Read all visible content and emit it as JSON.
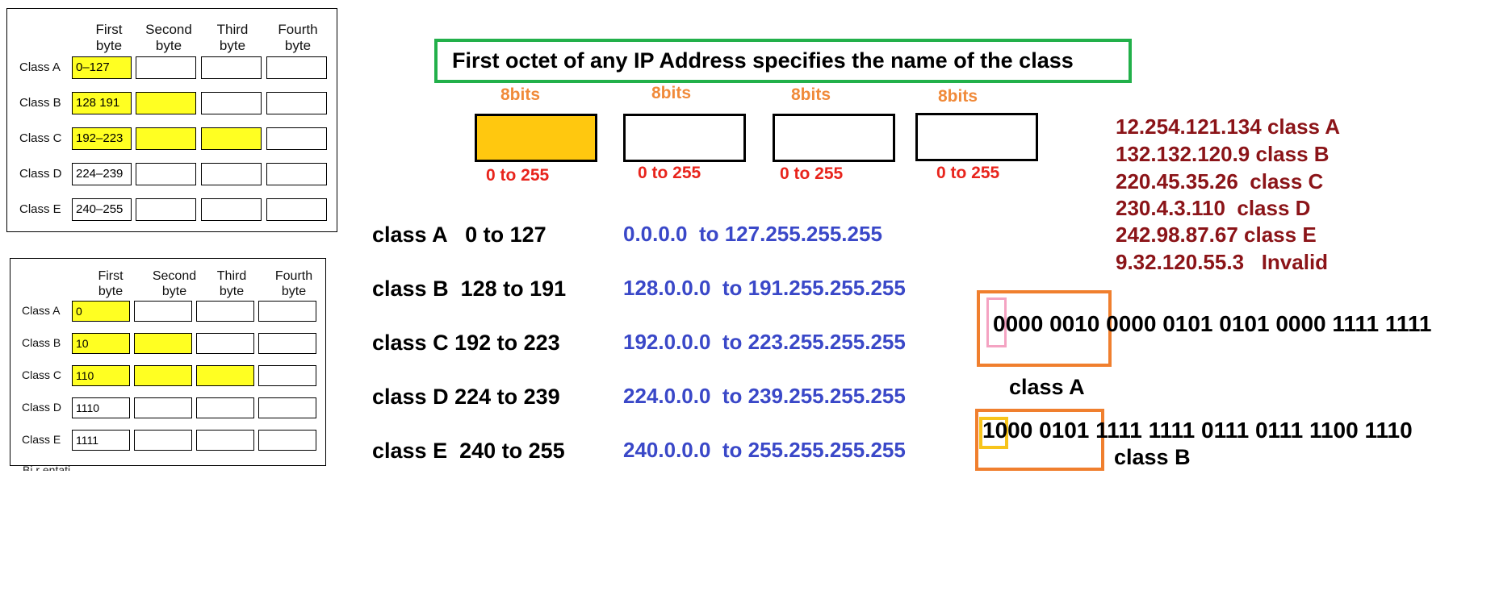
{
  "table1": {
    "headers": [
      "First byte",
      "Second byte",
      "Third byte",
      "Fourth byte"
    ],
    "rows": [
      {
        "label": "Class A",
        "value": "0–127",
        "filled": 1
      },
      {
        "label": "Class B",
        "value": "128  191",
        "filled": 2
      },
      {
        "label": "Class C",
        "value": "192–223",
        "filled": 3
      },
      {
        "label": "Class D",
        "value": "224–239",
        "filled": 0
      },
      {
        "label": "Class E",
        "value": "240–255",
        "filled": 0
      }
    ]
  },
  "table2": {
    "headers": [
      "First byte",
      "Second byte",
      "Third byte",
      "Fourth byte"
    ],
    "rows": [
      {
        "label": "Class A",
        "value": "0",
        "filled": 1
      },
      {
        "label": "Class B",
        "value": "10",
        "filled": 2
      },
      {
        "label": "Class C",
        "value": "110",
        "filled": 3
      },
      {
        "label": "Class D",
        "value": "1110",
        "filled": 0
      },
      {
        "label": "Class E",
        "value": "1111",
        "filled": 0
      }
    ],
    "cut_text": "Bi  r  entati"
  },
  "title": "First octet of any IP Address specifies the name of the class",
  "octets": [
    {
      "bits": "8bits",
      "range": "0 to 255"
    },
    {
      "bits": "8bits",
      "range": "0 to 255"
    },
    {
      "bits": "8bits",
      "range": "0 to 255"
    },
    {
      "bits": "8bits",
      "range": "0 to 255"
    }
  ],
  "classes": [
    {
      "name": "class A   0 to 127",
      "range": "0.0.0.0  to 127.255.255.255"
    },
    {
      "name": "class B  128 to 191",
      "range": "128.0.0.0  to 191.255.255.255"
    },
    {
      "name": "class C 192 to 223",
      "range": "192.0.0.0  to 223.255.255.255"
    },
    {
      "name": "class D 224 to 239",
      "range": "224.0.0.0  to 239.255.255.255"
    },
    {
      "name": "class E  240 to 255",
      "range": "240.0.0.0  to 255.255.255.255"
    }
  ],
  "examples": [
    "12.254.121.134 class A",
    "132.132.120.9 class B",
    "220.45.35.26  class C",
    "230.4.3.110  class D",
    "242.98.87.67 class E",
    "9.32.120.55.3   Invalid"
  ],
  "binary1": {
    "text": "0000 0010 0000 0101 0101 0000 1111 1111",
    "label": "class A"
  },
  "binary2": {
    "text": "1000 0101 1111 1111 0111 0111 1100 1110",
    "label": "class B"
  },
  "colors": {
    "title_border": "#22b04a",
    "bits": "#f08a3a",
    "octet_fill": "#ffc80f",
    "range": "#e8241c",
    "ip_range": "#3a48c8",
    "examples": "#8b1418",
    "highlight_box": "#f07f2e",
    "table_fill": "#ffff22"
  }
}
